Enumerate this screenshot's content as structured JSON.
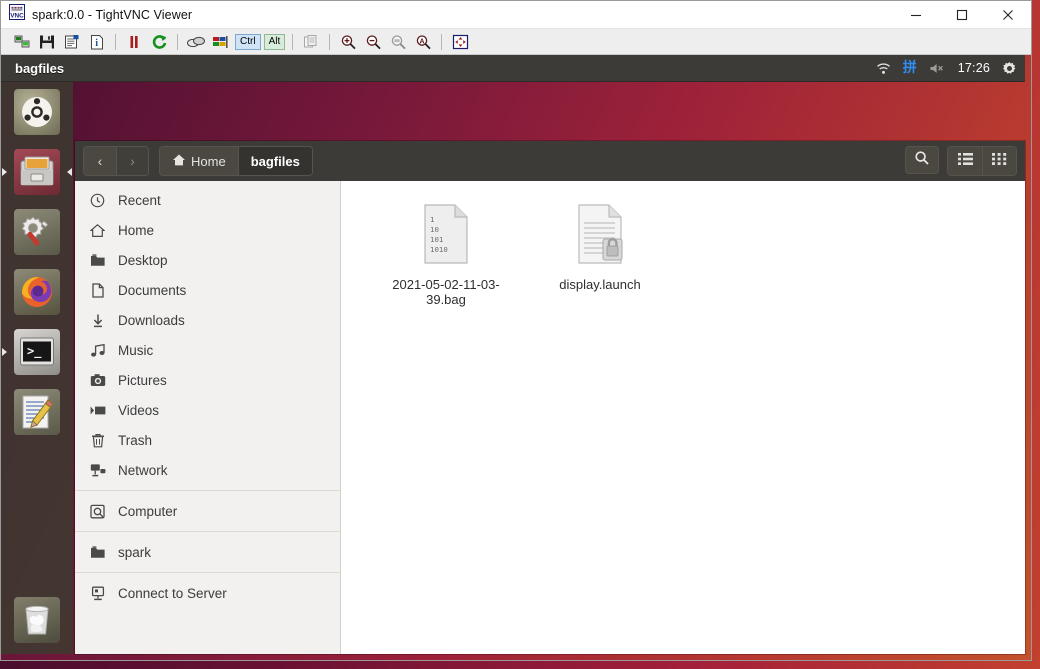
{
  "window": {
    "title": "spark:0.0 - TightVNC Viewer",
    "app_icon": "tightvnc-logo-icon",
    "controls": {
      "minimize": "minimize-button",
      "maximize": "maximize-button",
      "close": "close-button"
    }
  },
  "toolbar": {
    "items": [
      {
        "name": "new-connection",
        "tooltip": "New connection"
      },
      {
        "name": "save-session",
        "tooltip": "Save session"
      },
      {
        "name": "connection-options",
        "tooltip": "Connection options"
      },
      {
        "name": "connection-info",
        "tooltip": "Connection info"
      },
      {
        "name": "pause-updates",
        "tooltip": "Pause updates"
      },
      {
        "name": "refresh-screen",
        "tooltip": "Request screen refresh"
      },
      {
        "name": "send-ctrl-alt-del",
        "tooltip": "Send Ctrl-Alt-Del"
      },
      {
        "name": "send-ctrl-esc",
        "tooltip": "Send Ctrl-Esc"
      },
      {
        "name": "copy-clipboard",
        "tooltip": "Transfer clipboard"
      },
      {
        "name": "zoom-in",
        "tooltip": "Zoom in"
      },
      {
        "name": "zoom-out",
        "tooltip": "Zoom out"
      },
      {
        "name": "zoom-100",
        "tooltip": "Zoom 100%"
      },
      {
        "name": "zoom-auto",
        "tooltip": "Auto zoom"
      },
      {
        "name": "full-screen",
        "tooltip": "Full screen"
      }
    ],
    "ctrl_key_label": "Ctrl",
    "alt_key_label": "Alt"
  },
  "panel": {
    "window_title": "bagfiles",
    "clock": "17:26",
    "indicators": [
      {
        "name": "wifi-icon",
        "label": ""
      },
      {
        "name": "input-method-icon",
        "label": "拼"
      },
      {
        "name": "volume-muted-icon",
        "label": ""
      },
      {
        "name": "clock",
        "label": "17:26"
      },
      {
        "name": "system-menu-gear-icon",
        "label": ""
      }
    ]
  },
  "launcher": {
    "items": [
      {
        "name": "dash-home",
        "label": "Ubuntu Dash",
        "running": false,
        "focused": false
      },
      {
        "name": "files-nautilus",
        "label": "Files",
        "running": true,
        "focused": true
      },
      {
        "name": "system-settings",
        "label": "System Settings",
        "running": false,
        "focused": false
      },
      {
        "name": "firefox",
        "label": "Firefox Web Browser",
        "running": false,
        "focused": false
      },
      {
        "name": "terminal",
        "label": "Terminal",
        "running": true,
        "focused": false
      },
      {
        "name": "text-editor",
        "label": "Text Editor",
        "running": false,
        "focused": false
      }
    ],
    "trash": {
      "name": "trash",
      "label": "Trash"
    }
  },
  "file_manager": {
    "nav": {
      "back_label": "‹",
      "forward_label": "›"
    },
    "breadcrumbs": [
      {
        "label": "Home",
        "icon": "home-icon",
        "active": false
      },
      {
        "label": "bagfiles",
        "icon": "",
        "active": true
      }
    ],
    "header_buttons": [
      {
        "name": "search-button",
        "icon": "search-icon"
      },
      {
        "name": "list-view-button",
        "icon": "list-view-icon"
      },
      {
        "name": "grid-view-button",
        "icon": "grid-view-icon"
      }
    ],
    "sidebar": {
      "groups": [
        {
          "items": [
            {
              "label": "Recent",
              "icon": "clock-icon"
            },
            {
              "label": "Home",
              "icon": "home-icon"
            },
            {
              "label": "Desktop",
              "icon": "folder-icon"
            },
            {
              "label": "Documents",
              "icon": "document-icon"
            },
            {
              "label": "Downloads",
              "icon": "download-icon"
            },
            {
              "label": "Music",
              "icon": "music-icon"
            },
            {
              "label": "Pictures",
              "icon": "camera-icon"
            },
            {
              "label": "Videos",
              "icon": "video-icon"
            },
            {
              "label": "Trash",
              "icon": "trash-icon"
            },
            {
              "label": "Network",
              "icon": "network-icon"
            }
          ]
        },
        {
          "items": [
            {
              "label": "Computer",
              "icon": "computer-icon"
            }
          ]
        },
        {
          "items": [
            {
              "label": "spark",
              "icon": "folder-icon"
            }
          ]
        },
        {
          "items": [
            {
              "label": "Connect to Server",
              "icon": "server-icon"
            }
          ]
        }
      ]
    },
    "files": [
      {
        "name": "2021-05-02-11-03-39.bag",
        "icon": "binary-file-icon"
      },
      {
        "name": "display.launch",
        "icon": "locked-document-icon"
      }
    ]
  },
  "colors": {
    "panel_bg": "#3c3b37",
    "sidebar_bg": "#f2f1f0",
    "content_bg": "#ffffff",
    "accent_blue": "#2f8ef5",
    "desktop_gradient_start": "#4a1030",
    "desktop_gradient_end": "#c4512c"
  }
}
